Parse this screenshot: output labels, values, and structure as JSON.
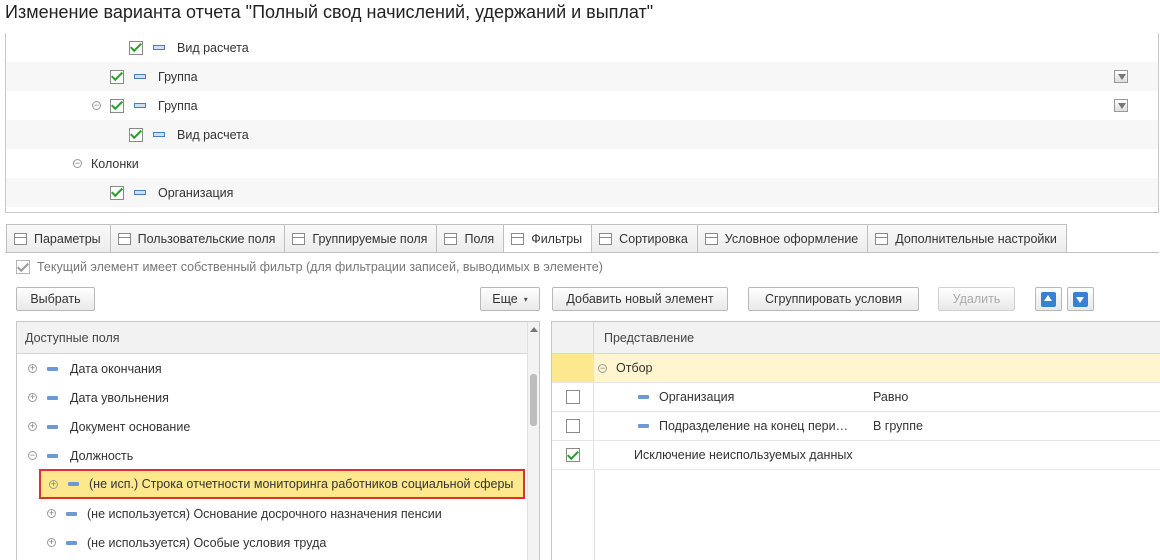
{
  "window": {
    "title": "Изменение варианта отчета \"Полный свод начислений, удержаний и выплат\""
  },
  "structure_tree": [
    {
      "label": "Вид расчета",
      "checked": true,
      "expander": "",
      "filter_icon": false
    },
    {
      "label": "Группа",
      "checked": true,
      "expander": "",
      "filter_icon": true
    },
    {
      "label": "Группа",
      "checked": true,
      "expander": "⊖",
      "filter_icon": true
    },
    {
      "label": "Вид расчета",
      "checked": true,
      "expander": "",
      "filter_icon": false
    },
    {
      "label": "Колонки",
      "checked": null,
      "expander": "⊖",
      "filter_icon": false
    },
    {
      "label": "Организация",
      "checked": true,
      "expander": "",
      "filter_icon": false
    }
  ],
  "tabs": [
    {
      "label": "Параметры",
      "icon": "table-icon",
      "active": false
    },
    {
      "label": "Пользовательские поля",
      "icon": "formula-icon",
      "active": false
    },
    {
      "label": "Группируемые поля",
      "icon": "grouping-icon",
      "active": false
    },
    {
      "label": "Поля",
      "icon": "fields-icon",
      "active": false
    },
    {
      "label": "Фильтры",
      "icon": "filter-icon",
      "active": true
    },
    {
      "label": "Сортировка",
      "icon": "sort-icon",
      "active": false
    },
    {
      "label": "Условное оформление",
      "icon": "brush-icon",
      "active": false
    },
    {
      "label": "Дополнительные настройки",
      "icon": "settings-icon",
      "active": false
    }
  ],
  "own_filter": {
    "label": "Текущий элемент имеет собственный фильтр (для фильтрации записей, выводимых в элементе)",
    "checked": true
  },
  "toolbar": {
    "select_label": "Выбрать",
    "more_label": "Еще",
    "add_label": "Добавить новый элемент",
    "group_label": "Сгруппировать условия",
    "delete_label": "Удалить"
  },
  "available_fields": {
    "header": "Доступные поля",
    "items": [
      {
        "label": "Дата окончания",
        "expander": "⊕"
      },
      {
        "label": "Дата увольнения",
        "expander": "⊕"
      },
      {
        "label": "Документ основание",
        "expander": "⊕"
      },
      {
        "label": "Должность",
        "expander": "⊖"
      },
      {
        "label": "(не исп.) Строка отчетности мониторинга работников социальной сферы",
        "expander": "⊕",
        "highlighted": true
      },
      {
        "label": "(не используется) Основание досрочного назначения пенсии",
        "expander": "⊕"
      },
      {
        "label": "(не используется) Особые условия труда",
        "expander": "⊕"
      }
    ]
  },
  "filter_list": {
    "header": "Представление",
    "items": [
      {
        "label": "Отбор",
        "expander": "⊖",
        "checked": null,
        "condition": ""
      },
      {
        "label": "Организация",
        "checked": false,
        "condition": "Равно"
      },
      {
        "label": "Подразделение на конец пери…",
        "checked": false,
        "condition": "В группе"
      },
      {
        "label": "Исключение неиспользуемых данных",
        "checked": true,
        "condition": ""
      }
    ]
  },
  "colors": {
    "highlight": "#fde88d",
    "highlight_border": "#e03030",
    "check": "#2c9e2c",
    "accent": "#3b7fd4"
  }
}
